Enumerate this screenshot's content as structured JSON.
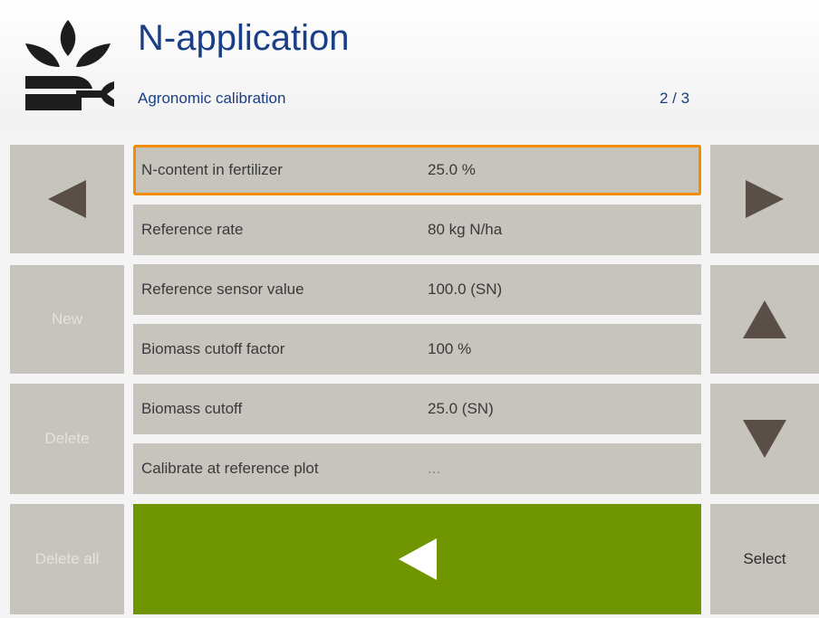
{
  "header": {
    "title": "N-application",
    "subtitle": "Agronomic calibration",
    "page_indicator": "2 / 3",
    "logo_icon": "plant-wrench-icon"
  },
  "left_buttons": {
    "back_icon": "arrow-left-icon",
    "new_label": "New",
    "delete_label": "Delete",
    "delete_all_label": "Delete all"
  },
  "right_buttons": {
    "next_icon": "arrow-right-icon",
    "up_icon": "arrow-up-icon",
    "down_icon": "arrow-down-icon",
    "select_label": "Select"
  },
  "rows": [
    {
      "label": "N-content in fertilizer",
      "value": "25.0 %",
      "selected": true
    },
    {
      "label": "Reference rate",
      "value": "80 kg N/ha",
      "selected": false
    },
    {
      "label": "Reference sensor value",
      "value": "100.0 (SN)",
      "selected": false
    },
    {
      "label": "Biomass cutoff factor",
      "value": "100 %",
      "selected": false
    },
    {
      "label": "Biomass cutoff",
      "value": "25.0 (SN)",
      "selected": false
    },
    {
      "label": "Calibrate at reference plot",
      "value": "...",
      "selected": false
    }
  ],
  "confirm": {
    "icon": "confirm-arrow-left-icon"
  },
  "colors": {
    "title": "#1a3f86",
    "button_bg": "#c7c3bd",
    "selection_border": "#f28c00",
    "confirm_bg": "#6f9600",
    "arrow": "#5a4f47"
  }
}
